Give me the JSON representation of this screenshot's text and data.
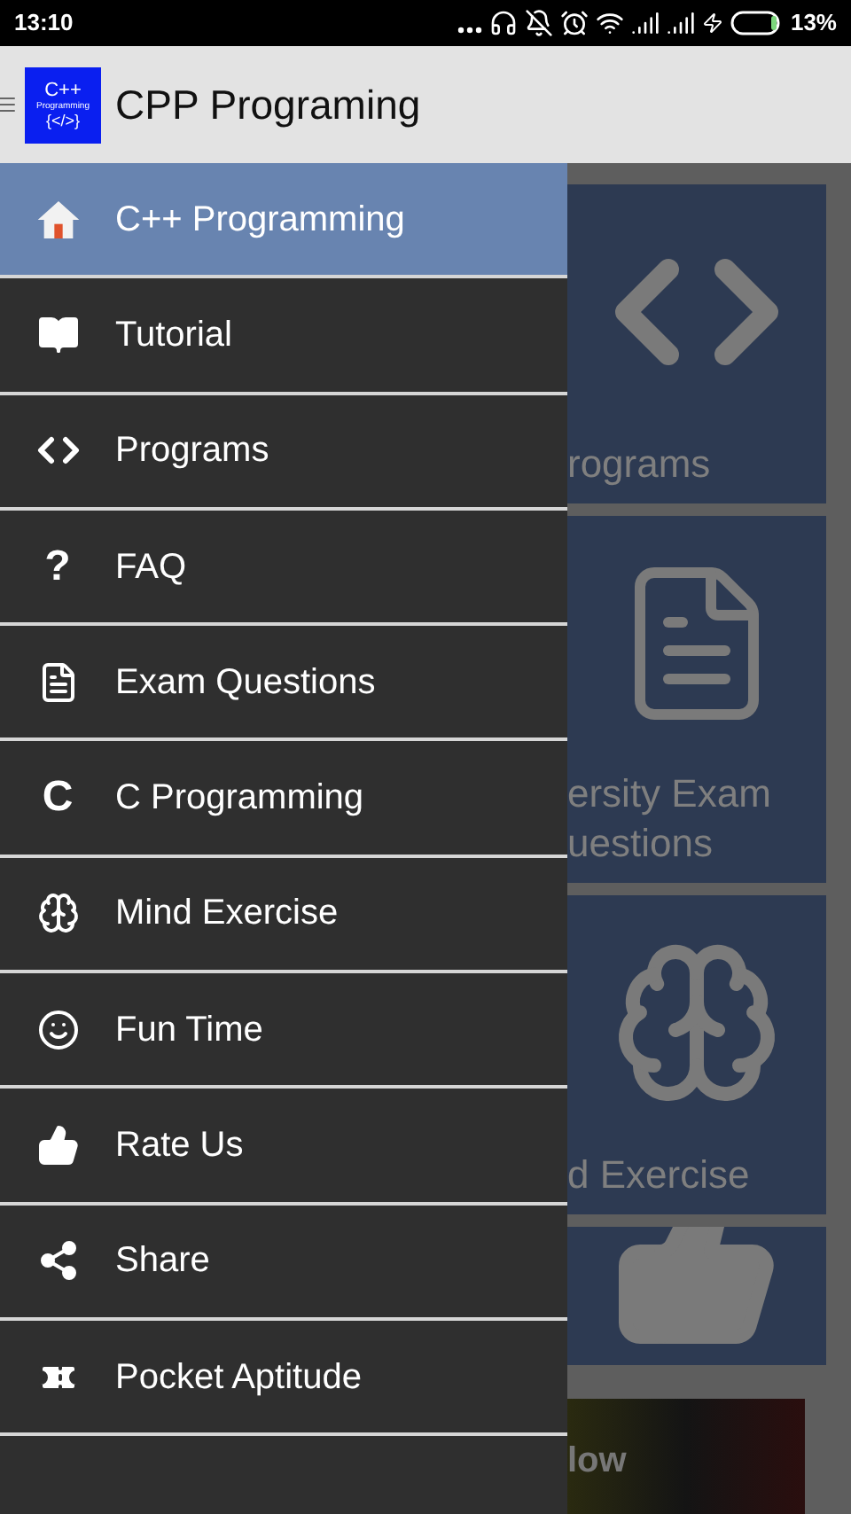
{
  "status_bar": {
    "time": "13:10",
    "battery_percent": "13%"
  },
  "app_bar": {
    "logo": {
      "line_1": "C++",
      "line_2": "Programming",
      "line_3": "{</>}"
    },
    "title": "CPP Programing"
  },
  "drawer": {
    "items": [
      {
        "label": "C++ Programming",
        "kind": "home",
        "selected": true
      },
      {
        "label": "Tutorial",
        "kind": "book",
        "selected": false
      },
      {
        "label": "Programs",
        "kind": "code",
        "selected": false
      },
      {
        "label": "FAQ",
        "kind": "glyph",
        "glyph": "?",
        "selected": false
      },
      {
        "label": "Exam Questions",
        "kind": "document",
        "selected": false
      },
      {
        "label": "C Programming",
        "kind": "glyph",
        "glyph": "C",
        "selected": false
      },
      {
        "label": "Mind Exercise",
        "kind": "brain",
        "selected": false
      },
      {
        "label": "Fun Time",
        "kind": "smile",
        "selected": false
      },
      {
        "label": "Rate Us",
        "kind": "thumb",
        "selected": false
      },
      {
        "label": "Share",
        "kind": "share",
        "selected": false
      },
      {
        "label": "Pocket Aptitude",
        "kind": "tag",
        "selected": false
      }
    ]
  },
  "background_tiles": [
    {
      "kind": "code",
      "lines": [
        "rograms"
      ]
    },
    {
      "kind": "document",
      "lines": [
        "ersity Exam",
        "uestions"
      ]
    },
    {
      "kind": "brain",
      "lines": [
        "d Exercise"
      ]
    },
    {
      "kind": "thumb"
    }
  ],
  "banner": {
    "text": "low"
  }
}
